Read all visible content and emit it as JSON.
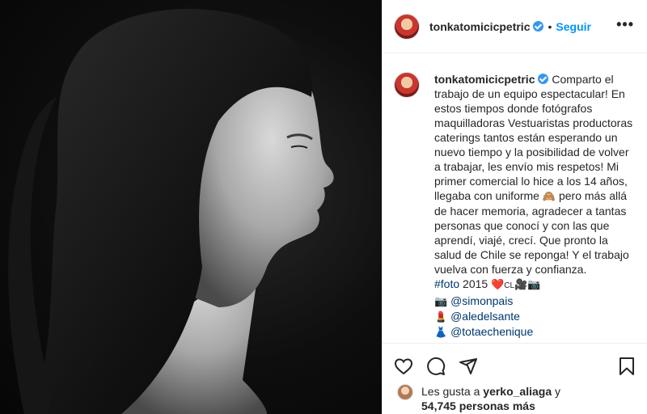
{
  "post": {
    "username": "tonkatomicicpetric",
    "separator": "•",
    "follow_label": "Seguir",
    "more_label": "•••"
  },
  "caption": {
    "username": "tonkatomicicpetric",
    "text_1": "Comparto el trabajo de un equipo espectacular! En estos tiempos donde fotógrafos maquilladoras Vestuaristas productoras caterings tantos están esperando un nuevo tiempo y la posibilidad de volver a trabajar, les envío mis respetos! Mi primer comercial lo hice a los 14 años, llegaba con uniforme",
    "emoji_1": "🙈",
    "text_2": "pero más allá de hacer memoria, agradecer a tantas personas que conocí y con las que aprendí, viajé, crecí. Que pronto la salud de Chile se reponga! Y el trabajo vuelva con fuerza y confianza.",
    "hashtag": "#foto",
    "year": "2015",
    "heart": "❤️",
    "cl": "CL",
    "camera_emoji": "🎥📷",
    "credit_1_icon": "📷",
    "credit_1": "@simonpais",
    "credit_2_icon": "💄",
    "credit_2": "@aledelsante",
    "credit_3_icon": "👗",
    "credit_3": "@totaechenique"
  },
  "likes": {
    "prefix": "Les gusta a",
    "user": "yerko_aliaga",
    "connector": "y",
    "count": "54,745 personas más"
  },
  "icons": {
    "like": "heart-icon",
    "comment": "comment-icon",
    "share": "share-icon",
    "save": "bookmark-icon"
  }
}
